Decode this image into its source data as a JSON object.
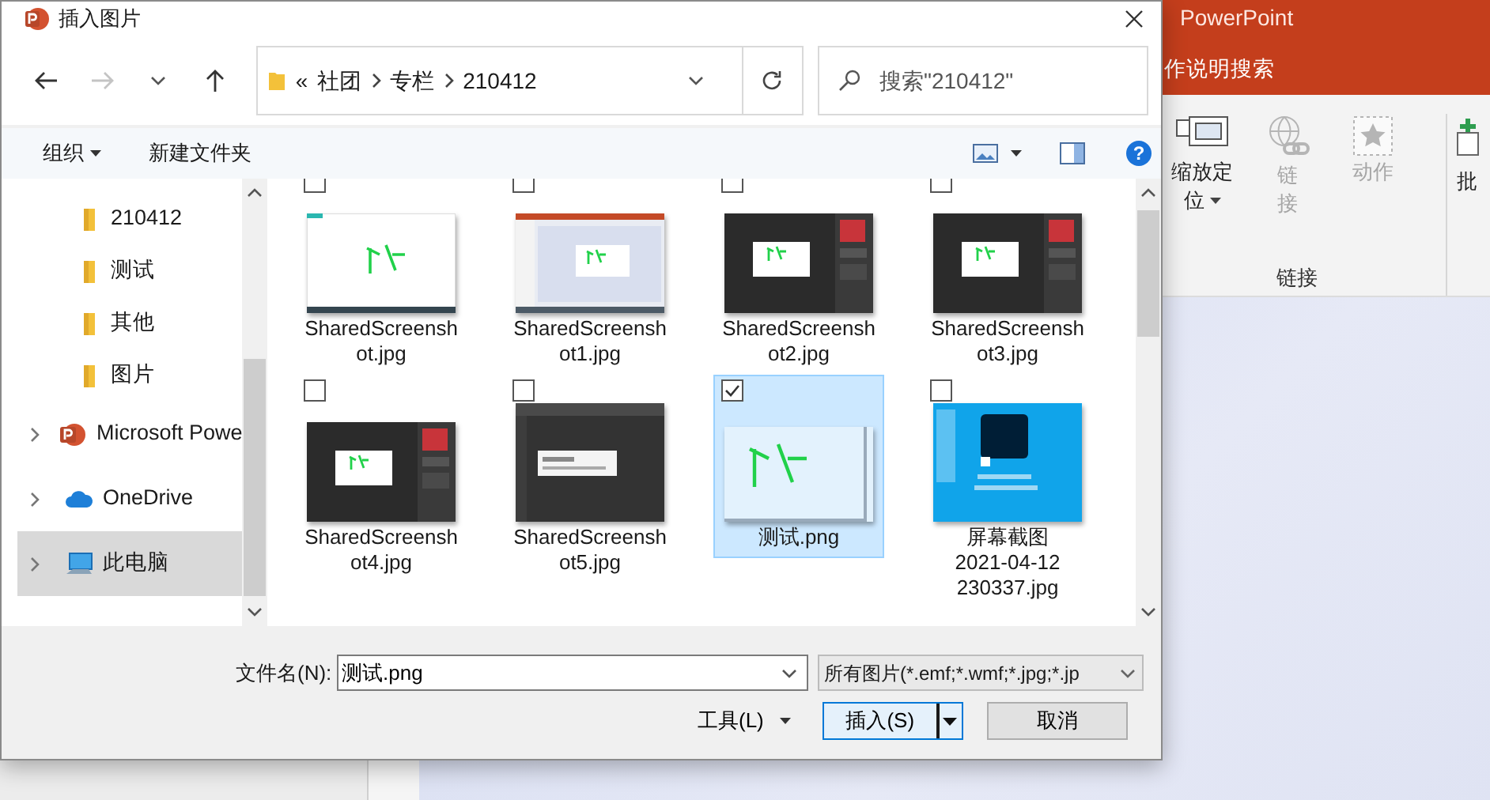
{
  "app": {
    "title": "PowerPoint",
    "search_hint": "作说明搜索",
    "ribbon": {
      "buttons": [
        {
          "kind": "zoom",
          "label_lines": [
            "缩放定",
            "位"
          ],
          "dropdown": true,
          "disabled": false
        },
        {
          "kind": "link",
          "label_lines": [
            "链",
            "接"
          ],
          "dropdown": false,
          "disabled": true
        },
        {
          "kind": "action",
          "label_lines": [
            "动作"
          ],
          "dropdown": false,
          "disabled": true
        }
      ],
      "group_label": "链接",
      "cut_label": "批"
    }
  },
  "dialog": {
    "title": "插入图片",
    "nav": {
      "back_disabled": false,
      "forward_disabled": true
    },
    "address": {
      "overflow": "«",
      "crumbs": [
        "社团",
        "专栏",
        "210412"
      ]
    },
    "search": {
      "placeholder": "搜索\"210412\""
    },
    "toolbar": {
      "organize": "组织",
      "new_folder": "新建文件夹",
      "help": "?"
    },
    "sidebar": [
      {
        "kind": "folder",
        "label": "210412",
        "selected": false
      },
      {
        "kind": "folder",
        "label": "测试",
        "selected": false
      },
      {
        "kind": "folder",
        "label": "其他",
        "selected": false
      },
      {
        "kind": "folder",
        "label": "图片",
        "selected": false
      },
      {
        "kind": "app",
        "label": "Microsoft Powe",
        "selected": false
      },
      {
        "kind": "cloud",
        "label": "OneDrive",
        "selected": false
      },
      {
        "kind": "computer",
        "label": "此电脑",
        "selected": true
      }
    ],
    "files": [
      {
        "kind": "white",
        "name_lines": [
          "SharedScreensh",
          "ot.jpg"
        ],
        "checked": false,
        "selected": false
      },
      {
        "kind": "slides",
        "name_lines": [
          "SharedScreensh",
          "ot1.jpg"
        ],
        "checked": false,
        "selected": false
      },
      {
        "kind": "dark",
        "name_lines": [
          "SharedScreensh",
          "ot2.jpg"
        ],
        "checked": false,
        "selected": false
      },
      {
        "kind": "dark",
        "name_lines": [
          "SharedScreensh",
          "ot3.jpg"
        ],
        "checked": false,
        "selected": false
      },
      {
        "kind": "dark",
        "name_lines": [
          "SharedScreensh",
          "ot4.jpg"
        ],
        "checked": false,
        "selected": false
      },
      {
        "kind": "tall",
        "name_lines": [
          "SharedScreensh",
          "ot5.jpg"
        ],
        "checked": false,
        "selected": false
      },
      {
        "kind": "page",
        "name_lines": [
          "测试.png"
        ],
        "checked": true,
        "selected": true
      },
      {
        "kind": "desktop",
        "name_lines": [
          "屏幕截图",
          "2021-04-12",
          "230337.jpg"
        ],
        "checked": false,
        "selected": false
      }
    ],
    "filename_label": "文件名(N):",
    "filename_value": "测试.png",
    "filter": "所有图片(*.emf;*.wmf;*.jpg;*.jp",
    "tools": "工具(L)",
    "insert": "插入(S)",
    "cancel": "取消"
  }
}
